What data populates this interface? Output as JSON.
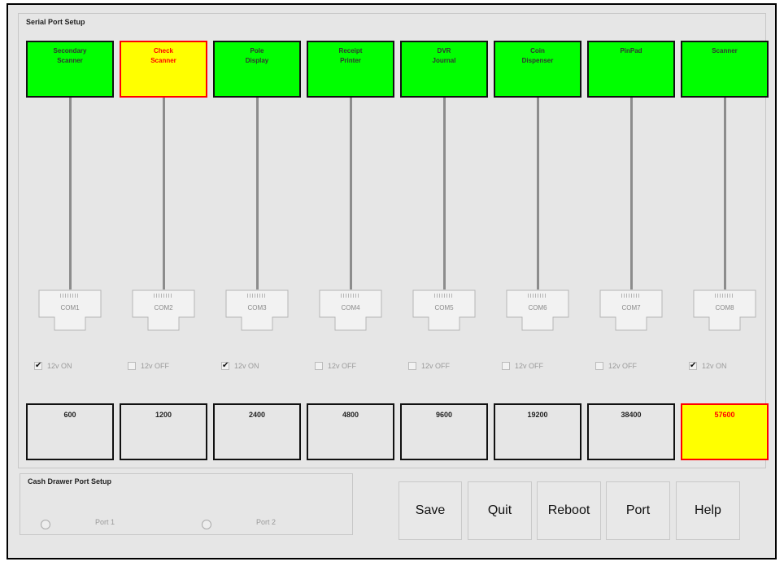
{
  "serial_group_title": "Serial Port Setup",
  "devices": [
    {
      "name": "Secondary\nScanner",
      "bg": "#00ff00",
      "color": "#333333"
    },
    {
      "name": "Check\nScanner",
      "bg": "#ffff00",
      "color": "#ff0000"
    },
    {
      "name": "Pole\nDisplay",
      "bg": "#00ff00",
      "color": "#333333"
    },
    {
      "name": "Receipt\nPrinter",
      "bg": "#00ff00",
      "color": "#333333"
    },
    {
      "name": "DVR\nJournal",
      "bg": "#00ff00",
      "color": "#333333"
    },
    {
      "name": "Coin\nDispenser",
      "bg": "#00ff00",
      "color": "#333333"
    },
    {
      "name": "PinPad",
      "bg": "#00ff00",
      "color": "#333333"
    },
    {
      "name": "Scanner",
      "bg": "#00ff00",
      "color": "#333333"
    }
  ],
  "ports": [
    "COM1",
    "COM2",
    "COM3",
    "COM4",
    "COM5",
    "COM6",
    "COM7",
    "COM8"
  ],
  "power": [
    {
      "label": "12v ON",
      "checked": true
    },
    {
      "label": "12v OFF",
      "checked": false
    },
    {
      "label": "12v ON",
      "checked": true
    },
    {
      "label": "12v OFF",
      "checked": false
    },
    {
      "label": "12v OFF",
      "checked": false
    },
    {
      "label": "12v OFF",
      "checked": false
    },
    {
      "label": "12v OFF",
      "checked": false
    },
    {
      "label": "12v ON",
      "checked": true
    }
  ],
  "baud_rates": [
    {
      "value": "600",
      "selected": false
    },
    {
      "value": "1200",
      "selected": false
    },
    {
      "value": "2400",
      "selected": false
    },
    {
      "value": "4800",
      "selected": false
    },
    {
      "value": "9600",
      "selected": false
    },
    {
      "value": "19200",
      "selected": false
    },
    {
      "value": "38400",
      "selected": false
    },
    {
      "value": "57600",
      "selected": true
    }
  ],
  "cash_drawer": {
    "title": "Cash Drawer Port Setup",
    "port1": "Port 1",
    "port2": "Port 2"
  },
  "buttons": {
    "save": "Save",
    "quit": "Quit",
    "reboot": "Reboot",
    "port": "Port",
    "help": "Help"
  },
  "colors": {
    "device_ok": "#00ff00",
    "highlight": "#ffff00",
    "highlight_border": "#ff0000",
    "baud_default": "#e6e6e6"
  }
}
